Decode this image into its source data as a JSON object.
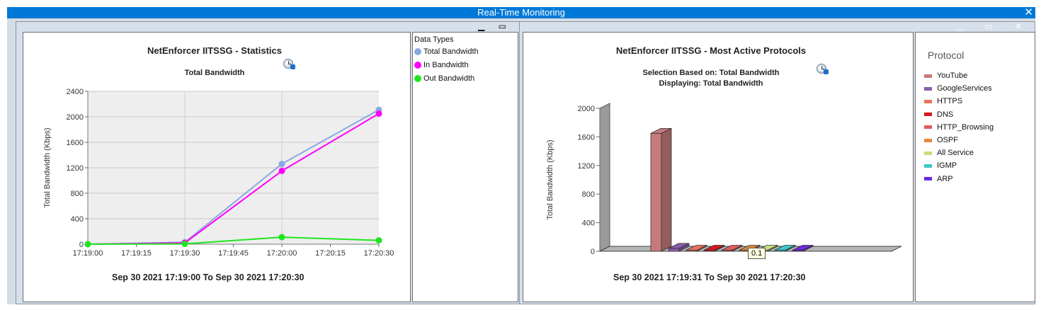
{
  "window": {
    "title": "Real-Time Monitoring",
    "close_glyph": "✕"
  },
  "left_panel": {
    "controls": "▁ ▭",
    "title": "NetEnforcer IITSSG - Statistics",
    "subtitle": "Total Bandwidth",
    "range": "Sep 30 2021  17:19:00  To  Sep 30 2021  17:20:30",
    "legend": {
      "title": "Data Types",
      "items": [
        {
          "label": "Total Bandwidth",
          "color": "#8aa9e0"
        },
        {
          "label": "In Bandwidth",
          "color": "#ff00ff"
        },
        {
          "label": "Out Bandwidth",
          "color": "#1ee61e"
        }
      ]
    }
  },
  "right_panel": {
    "controls": "_ ▭ ✕",
    "title": "NetEnforcer IITSSG - Most Active Protocols",
    "subtitle1": "Selection Based on: Total Bandwidth",
    "subtitle2": "Displaying: Total Bandwidth",
    "range": "Sep 30 2021  17:19:31  To  Sep 30 2021  17:20:30",
    "tooltip": "0.1",
    "legend": {
      "title": "Protocol",
      "items": [
        {
          "label": "YouTube",
          "color": "#c77a7a"
        },
        {
          "label": "GoogleServices",
          "color": "#8a5fa8"
        },
        {
          "label": "HTTPS",
          "color": "#e8735a"
        },
        {
          "label": "DNS",
          "color": "#d61a1a"
        },
        {
          "label": "HTTP_Browsing",
          "color": "#e05c5c"
        },
        {
          "label": "OSPF",
          "color": "#e08a3a"
        },
        {
          "label": "All Service",
          "color": "#c6e07a"
        },
        {
          "label": "IGMP",
          "color": "#3fc6c6"
        },
        {
          "label": "ARP",
          "color": "#6a2ae0"
        }
      ]
    }
  },
  "chart_data": [
    {
      "type": "line",
      "title": "NetEnforcer IITSSG - Statistics",
      "subtitle": "Total Bandwidth",
      "xlabel": "",
      "ylabel": "Total Bandwidth (Kbps)",
      "x": [
        "17:19:00",
        "17:19:30",
        "17:20:00",
        "17:20:30"
      ],
      "x_ticks": [
        "17:19:00",
        "17:19:15",
        "17:19:30",
        "17:19:45",
        "17:20:00",
        "17:20:15",
        "17:20:30"
      ],
      "ylim": [
        0,
        2400
      ],
      "y_ticks": [
        0,
        400,
        800,
        1200,
        1600,
        2000,
        2400
      ],
      "grid": true,
      "legend": "right",
      "series": [
        {
          "name": "Total Bandwidth",
          "color": "#8aa9e0",
          "values": [
            0,
            30,
            1260,
            2110
          ]
        },
        {
          "name": "In Bandwidth",
          "color": "#ff00ff",
          "values": [
            0,
            20,
            1150,
            2050
          ]
        },
        {
          "name": "Out Bandwidth",
          "color": "#1ee61e",
          "values": [
            0,
            5,
            110,
            60
          ]
        }
      ]
    },
    {
      "type": "bar",
      "title": "NetEnforcer IITSSG - Most Active Protocols",
      "subtitle": "Selection Based on: Total Bandwidth / Displaying: Total Bandwidth",
      "xlabel": "",
      "ylabel": "Total Bandwidth (Kbps)",
      "ylim": [
        0,
        2000
      ],
      "y_ticks": [
        0,
        400,
        800,
        1200,
        1600,
        2000
      ],
      "legend": "right",
      "categories": [
        "YouTube",
        "GoogleServices",
        "HTTPS",
        "DNS",
        "HTTP_Browsing",
        "OSPF",
        "All Service",
        "IGMP",
        "ARP"
      ],
      "values": [
        1650,
        40,
        10,
        5,
        4,
        1,
        0.1,
        0.1,
        0.1
      ]
    }
  ]
}
